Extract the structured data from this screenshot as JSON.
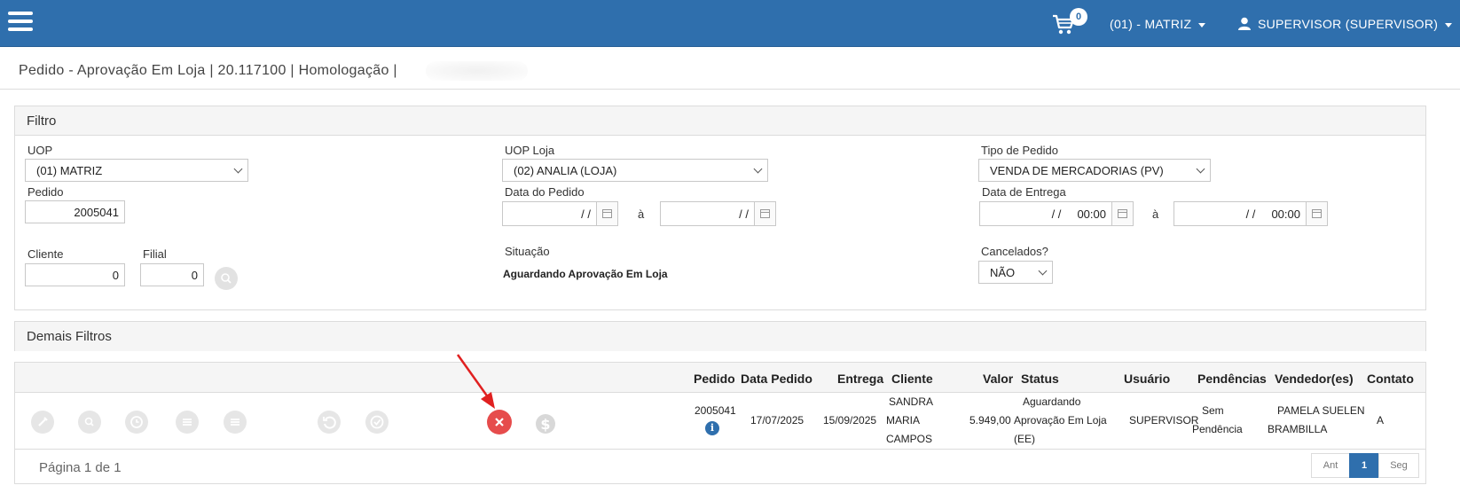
{
  "topbar": {
    "cart_count": "0",
    "branch": "(01) - MATRIZ",
    "user": "SUPERVISOR (SUPERVISOR)",
    "brand_color": "#2f6fad"
  },
  "page": {
    "title": "Pedido - Aprovação Em Loja | 20.117100 | Homologação |"
  },
  "filter": {
    "header": "Filtro",
    "uop_label": "UOP",
    "uop_value": "(01) MATRIZ",
    "pedido_label": "Pedido",
    "pedido_value": "2005041",
    "cliente_label": "Cliente",
    "cliente_value": "0",
    "filial_label": "Filial",
    "filial_value": "0",
    "uop_loja_label": "UOP Loja",
    "uop_loja_value": "(02) ANALIA (LOJA)",
    "data_pedido_label": "Data do Pedido",
    "data_pedido_from": "/ /",
    "data_pedido_to": "/ /",
    "ate_label": "à",
    "situacao_label": "Situação",
    "situacao_value": "Aguardando Aprovação Em Loja",
    "tipo_pedido_label": "Tipo de Pedido",
    "tipo_pedido_value": "VENDA DE MERCADORIAS (PV)",
    "data_entrega_label": "Data de Entrega",
    "data_entrega_from": "/ /     00:00",
    "data_entrega_to": "/ /     00:00",
    "cancelados_label": "Cancelados?",
    "cancelados_value": "NÃO"
  },
  "other_filters": {
    "header": "Demais Filtros"
  },
  "grid": {
    "columns": {
      "pedido": "Pedido",
      "data_pedido": "Data Pedido",
      "entrega": "Entrega",
      "cliente": "Cliente",
      "valor": "Valor",
      "status": "Status",
      "usuario": "Usuário",
      "pendencias": "Pendências",
      "vendedores": "Vendedor(es)",
      "contato": "Contato"
    },
    "rows": [
      {
        "pedido": "2005041",
        "data_pedido": "17/07/2025",
        "entrega": "15/09/2025",
        "cliente_l1": "SANDRA",
        "cliente_l2": "MARIA",
        "cliente_l3": "CAMPOS",
        "valor": "5.949,00",
        "status_l1": "Aguardando",
        "status_l2": "Aprovação Em Loja",
        "status_l3": "(EE)",
        "usuario": "SUPERVISOR",
        "pendencias_l1": "Sem",
        "pendencias_l2": "Pendência",
        "vendedor_l1": "PAMELA SUELEN",
        "vendedor_l2": "BRAMBILLA",
        "contato": "A"
      }
    ],
    "page_info": "Página 1 de 1",
    "pager": {
      "prev": "Ant",
      "current": "1",
      "next": "Seg"
    }
  }
}
